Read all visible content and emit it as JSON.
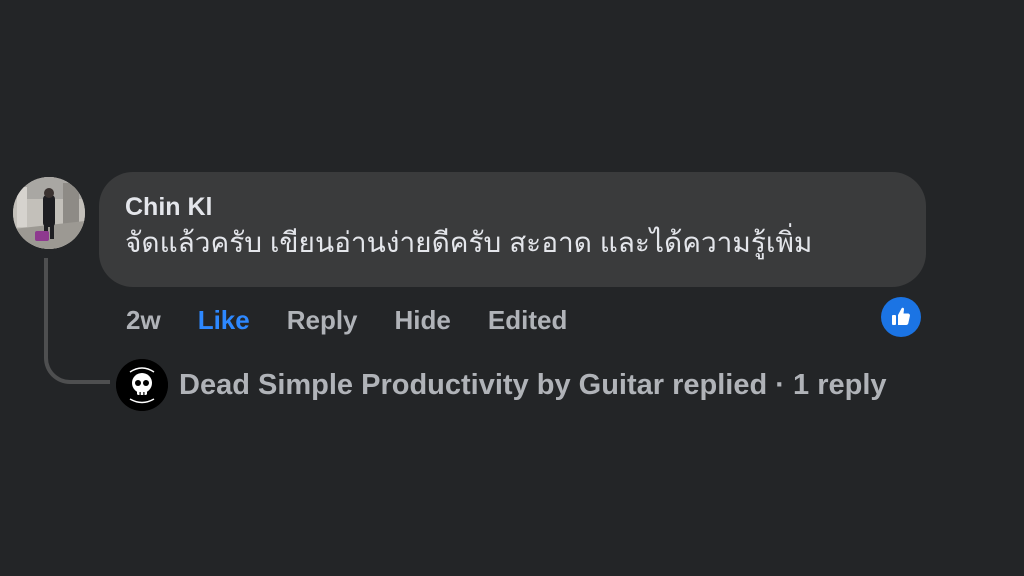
{
  "comment": {
    "author": "Chin Kl",
    "text": "จัดแล้วครับ เขียนอ่านง่ายดีครับ สะอาด และได้ความรู้เพิ่ม",
    "time": "2w",
    "actions": {
      "like": "Like",
      "reply": "Reply",
      "hide": "Hide",
      "edited": "Edited"
    },
    "reaction_icon": "like-thumbs-up-icon",
    "accent_color": "#2d88ff"
  },
  "reply_summary": {
    "page_name": "Dead Simple Productivity by Guitar",
    "replied_word": "replied",
    "separator": "·",
    "count_text": "1 reply",
    "avatar_logo_text": "Dead Simple Productivity"
  }
}
